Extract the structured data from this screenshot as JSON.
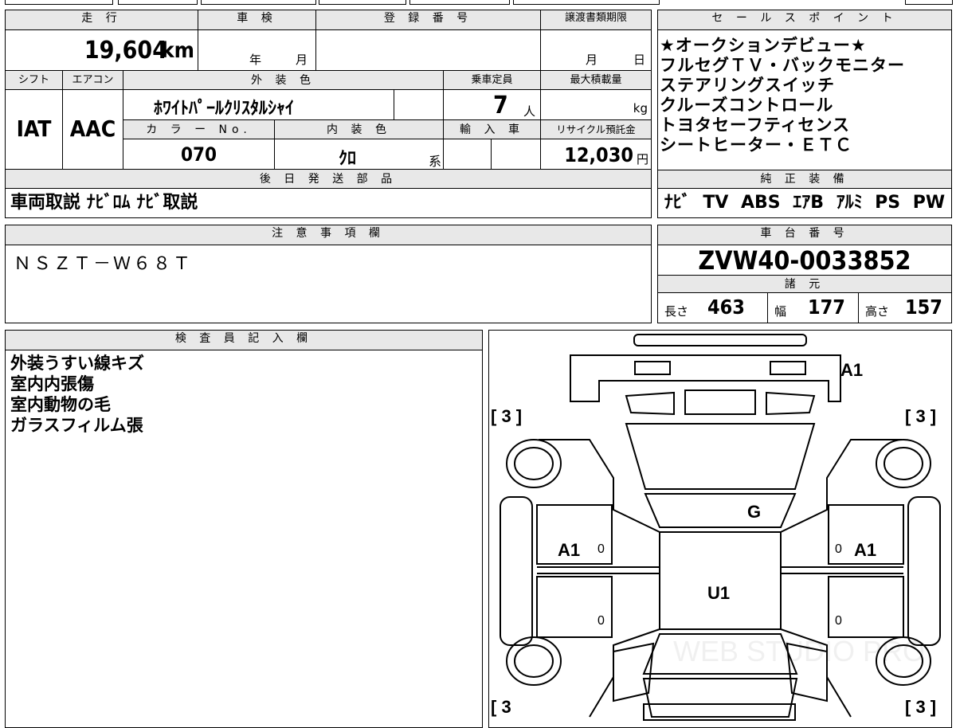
{
  "vehicle": {
    "mileage_label": "走 行",
    "mileage_value": "19,604",
    "mileage_unit": "km",
    "inspection_label": "車 検",
    "inspection_year_unit": "年",
    "inspection_month_unit": "月",
    "registration_label": "登 録 番 号",
    "transfer_deadline_label": "譲渡書類期限",
    "transfer_month_unit": "月",
    "transfer_day_unit": "日",
    "shift_label": "シフト",
    "shift_value": "IAT",
    "ac_label": "エアコン",
    "ac_value": "AAC",
    "exterior_color_label": "外 装 色",
    "exterior_color_value": "ﾎﾜｲﾄﾊﾟｰﾙｸﾘｽﾀﾙｼｬｲ",
    "capacity_label": "乗車定員",
    "capacity_value": "7",
    "capacity_unit": "人",
    "max_load_label": "最大積載量",
    "max_load_unit": "kg",
    "color_no_label": "カ ラ ー No.",
    "color_no_value": "070",
    "interior_color_label": "内 装 色",
    "interior_color_value": "ｸﾛ",
    "interior_color_suffix": "系",
    "import_label": "輸 入 車",
    "recycle_label": "リサイクル預託金",
    "recycle_value": "12,030",
    "recycle_unit": "円",
    "later_parts_label": "後 日 発 送 部 品",
    "later_parts_value": "車両取説 ﾅﾋﾞﾛﾑ ﾅﾋﾞ取説"
  },
  "sales_points": {
    "label": "セ ー ル ス ポ イ ン ト",
    "lines": [
      "★オークションデビュー★",
      "フルセグＴＶ・バックモニター",
      "ステアリングスイッチ",
      "クルーズコントロール",
      "トヨタセーフティセンス",
      "シートヒーター・ＥＴＣ"
    ]
  },
  "equipment": {
    "label": "純 正 装 備",
    "items": [
      "ﾅﾋﾞ",
      "TV",
      "ABS",
      "ｴｱB",
      "ｱﾙﾐ",
      "PS",
      "PW"
    ]
  },
  "notes": {
    "label": "注 意 事 項 欄",
    "value": "ＮＳＺＴ－Ｗ６８Ｔ"
  },
  "chassis": {
    "label": "車 台 番 号",
    "value": "ZVW40-0033852"
  },
  "specs": {
    "label": "諸 元",
    "length_label": "長さ",
    "length_value": "463",
    "width_label": "幅",
    "width_value": "177",
    "height_label": "高さ",
    "height_value": "157"
  },
  "inspector": {
    "label": "検 査 員 記 入 欄",
    "lines": [
      "外装うすい線キズ",
      "室内内張傷",
      "室内動物の毛",
      "ガラスフィルム張"
    ]
  },
  "diagram": {
    "marks": {
      "front_right": "A1",
      "windshield": "G",
      "left_door": "A1",
      "right_door": "A1",
      "roof": "U1",
      "door_zero_1": "0",
      "door_zero_2": "0",
      "door_zero_3": "0",
      "door_zero_4": "0",
      "tire_fl": "[ 3 ]",
      "tire_fr": "[ 3 ]",
      "tire_rl": "[ 3",
      "tire_rr": "[ 3 ]"
    },
    "watermark": "WEB STUDIO PRO"
  }
}
